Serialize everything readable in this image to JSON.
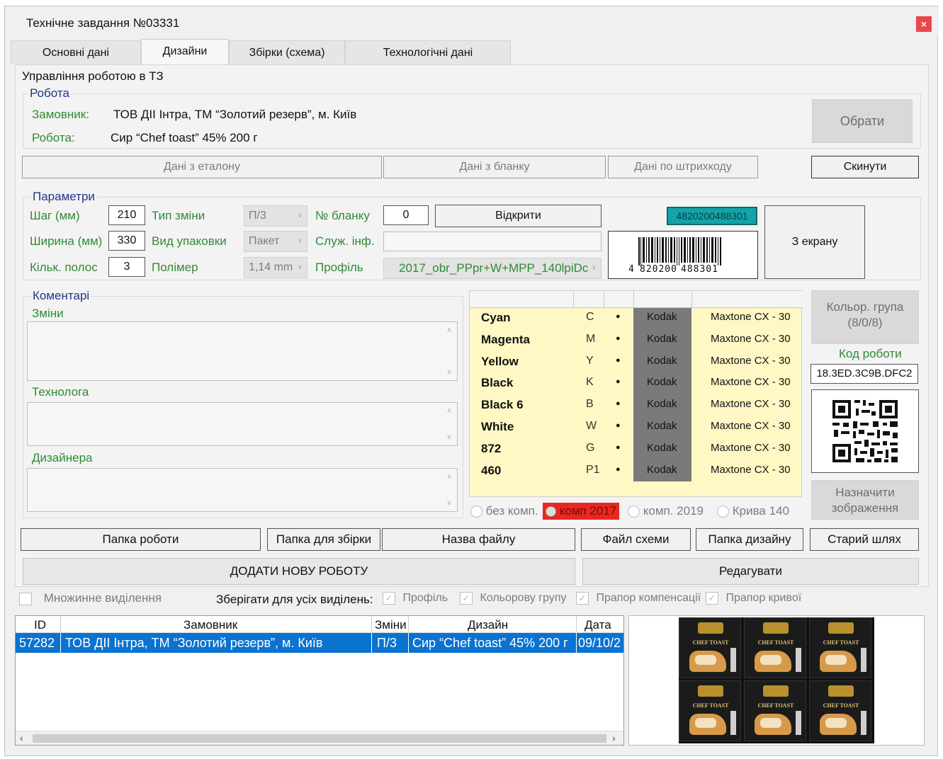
{
  "window": {
    "title": "Технічне завдання №03331",
    "close_label": "×"
  },
  "tabs": [
    {
      "label": "Основні дані",
      "active": false
    },
    {
      "label": "Дизайни",
      "active": true
    },
    {
      "label": "Збірки (схема)",
      "active": false
    },
    {
      "label": "Технологічні дані",
      "active": false
    }
  ],
  "management": {
    "group_label": "Управління роботою в ТЗ",
    "work_group_label": "Робота",
    "customer_label": "Замовник:",
    "customer_value": "ТОВ ДІІ Інтра, ТМ “Золотий резерв”, м. Київ",
    "work_label": "Робота:",
    "work_value": "Сир “Chef toast” 45% 200 г",
    "choose_button": "Обрати"
  },
  "data_buttons": {
    "etalon": "Дані з еталону",
    "blank": "Дані з бланку",
    "barcode": "Дані по штрихкоду",
    "reset": "Скинути"
  },
  "params": {
    "group_label": "Параметри",
    "step_label": "Шаг (мм)",
    "step_value": "210",
    "width_label": "Ширина (мм)",
    "width_value": "330",
    "strips_label": "Кільк. полос",
    "strips_value": "3",
    "shift_type_label": "Тип зміни",
    "shift_type_value": "П/3",
    "pack_type_label": "Вид упаковки",
    "pack_type_value": "Пакет",
    "polymer_label": "Полімер",
    "polymer_value": "1,14 mm",
    "blank_no_label": "№ бланку",
    "blank_no_value": "0",
    "service_info_label": "Служ. інф.",
    "service_info_value": "",
    "profile_label": "Профіль",
    "profile_value": "2017_obr_PPpr+W+MPP_140lpiDc",
    "open_button": "Відкрити",
    "barcode_value": "4820200488301",
    "barcode_digits_left": "4",
    "barcode_digits_mid": "820200",
    "barcode_digits_right": "488301",
    "from_screen_button": "З екрану"
  },
  "comments": {
    "group_label": "Коментарі",
    "changes_label": "Зміни",
    "technologist_label": "Технолога",
    "designer_label": "Дизайнера"
  },
  "inks": [
    {
      "name": "Cyan",
      "code": "C",
      "dot": "●",
      "vendor": "Kodak",
      "plate": "Maxtone CX - 30"
    },
    {
      "name": "Magenta",
      "code": "M",
      "dot": "●",
      "vendor": "Kodak",
      "plate": "Maxtone CX - 30"
    },
    {
      "name": "Yellow",
      "code": "Y",
      "dot": "●",
      "vendor": "Kodak",
      "plate": "Maxtone CX - 30"
    },
    {
      "name": "Black",
      "code": "K",
      "dot": "●",
      "vendor": "Kodak",
      "plate": "Maxtone CX - 30"
    },
    {
      "name": "Black 6",
      "code": "B",
      "dot": "●",
      "vendor": "Kodak",
      "plate": "Maxtone CX - 30"
    },
    {
      "name": "White",
      "code": "W",
      "dot": "●",
      "vendor": "Kodak",
      "plate": "Maxtone CX - 30"
    },
    {
      "name": "872",
      "code": "G",
      "dot": "●",
      "vendor": "Kodak",
      "plate": "Maxtone CX - 30"
    },
    {
      "name": "460",
      "code": "P1",
      "dot": "●",
      "vendor": "Kodak",
      "plate": "Maxtone CX - 30"
    }
  ],
  "compensation": {
    "none": "без комп.",
    "c2017": "комп 2017",
    "c2019": "комп. 2019",
    "curve": "Крива 140"
  },
  "side": {
    "color_group_button": "Кольор. група",
    "color_group_value": "(8/0/8)",
    "work_code_label": "Код роботи",
    "work_code_value": "18.3ED.3C9B.DFC2",
    "assign_image_button": "Назначити",
    "assign_image_button_line2": "зображення"
  },
  "folder_buttons": {
    "work_folder": "Папка роботи",
    "assembly_folder": "Папка для збірки",
    "file_name": "Назва файлу",
    "scheme_file": "Файл схеми",
    "design_folder": "Папка дизайну",
    "old_path": "Старий шлях"
  },
  "add_button": "ДОДАТИ НОВУ РОБОТУ",
  "edit_button": "Редагувати",
  "selection": {
    "multi_label": "Множинне виділення",
    "save_for_all_label": "Зберігати для усіх виділень:",
    "profile": "Профіль",
    "color_group": "Кольорову групу",
    "comp_flag": "Прапор компенсації",
    "curve_flag": "Прапор кривої"
  },
  "table": {
    "headers": [
      "ID",
      "Замовник",
      "Зміни",
      "Дизайн",
      "Дата"
    ],
    "rows": [
      [
        "57282",
        "ТОВ ДІІ Інтра, ТМ “Золотий резерв”, м. Київ",
        "П/3",
        "Сир “Chef toast” 45% 200 г",
        "09/10/2"
      ]
    ]
  },
  "preview": {
    "label_top": "ЗОЛОТИЙ РЕЗЕРВ",
    "label_product": "CHEF TOAST"
  },
  "colors": {
    "accent_blue": "#0a73d1",
    "ink_bg": "#fff8c4",
    "kodak_col": "#7a7a7a",
    "barcode_field": "#14a3a8",
    "comp_selected": "#e8281f"
  }
}
